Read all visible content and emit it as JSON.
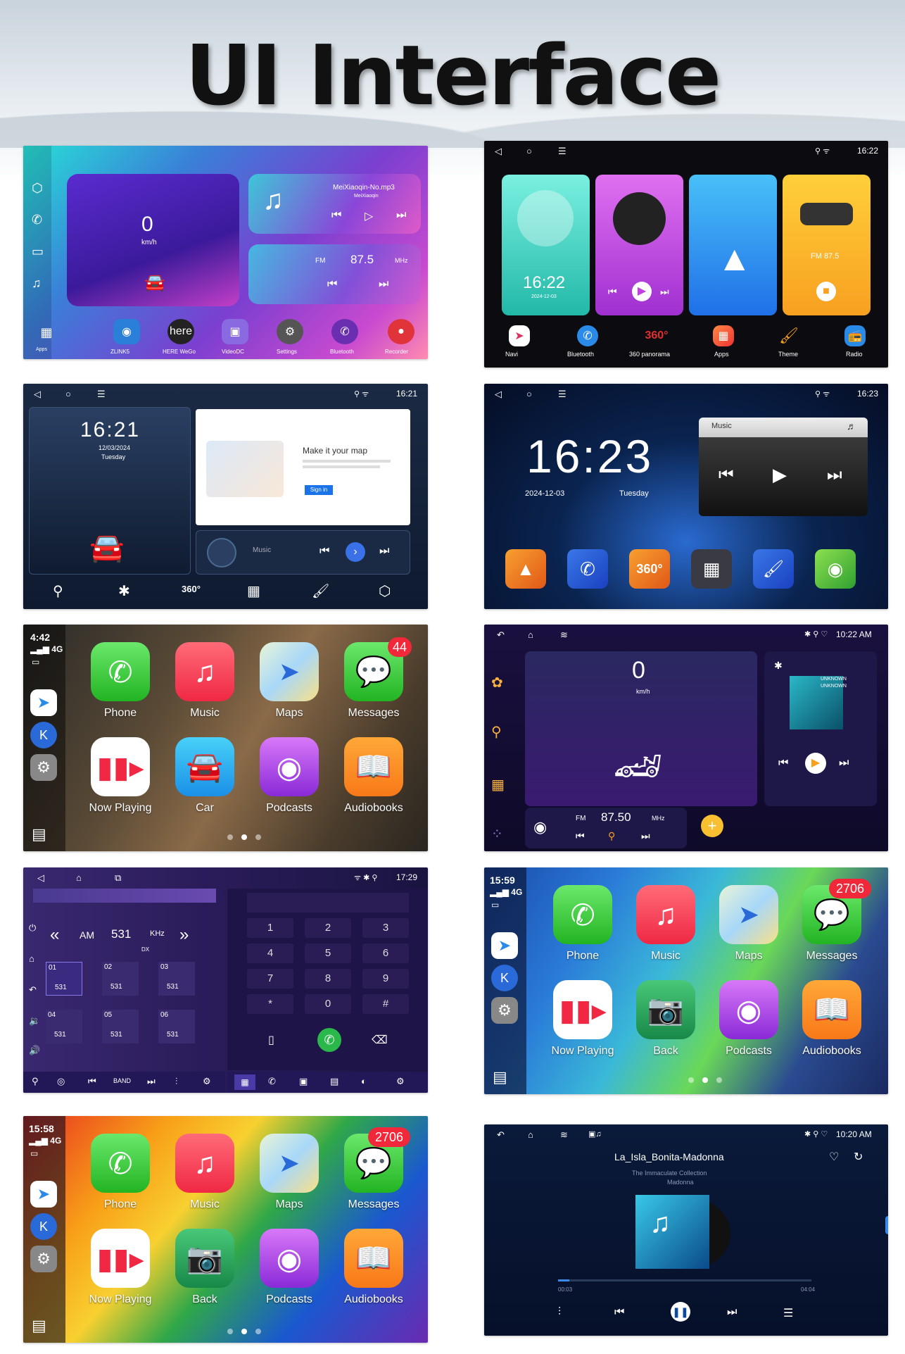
{
  "title": "UI Interface",
  "s1": {
    "speed": "0",
    "unit": "km/h",
    "song": "MeiXiaoqin-No.mp3",
    "artist": "MeiXiaoqin",
    "fm": "FM",
    "freq": "87.5",
    "mhz": "MHz",
    "apps": [
      "Apps",
      "ZLINK5",
      "HERE WeGo",
      "VideoDC",
      "Settings",
      "Bluetooth",
      "Recorder"
    ]
  },
  "s2": {
    "time": "16:22",
    "clock": "16:22",
    "date": "2024-12-03",
    "fm": "FM 87.5",
    "apps": [
      "Navi",
      "Bluetooth",
      "360 panorama",
      "Apps",
      "Theme",
      "Radio"
    ]
  },
  "s3": {
    "time": "16:21",
    "clock": "16:21",
    "date": "12/03/2024",
    "weekday": "Tuesday",
    "map_title": "Make it your map",
    "map_btn": "Sign in",
    "music": "Music"
  },
  "s4": {
    "time": "16:23",
    "clock": "16:23",
    "date": "2024-12-03",
    "weekday": "Tuesday",
    "music": "Music"
  },
  "s5": {
    "time": "4:42",
    "signal": "4G",
    "badge": "44",
    "dots": [
      false,
      true,
      false
    ],
    "apps": [
      "Phone",
      "Music",
      "Maps",
      "Messages",
      "Now Playing",
      "Car",
      "Podcasts",
      "Audiobooks"
    ]
  },
  "s6": {
    "time": "10:22 AM",
    "speed": "0",
    "unit": "km/h",
    "song": "UNKNOWN",
    "artist": "UNKNOWN",
    "fm": "FM",
    "freq": "87.50",
    "mhz": "MHz"
  },
  "s7": {
    "time": "17:29",
    "band": "AM",
    "freq": "531",
    "khz": "KHz",
    "dx": "DX",
    "presets": [
      "01",
      "02",
      "03",
      "04",
      "05",
      "06"
    ],
    "preset_freq": "531",
    "keys": [
      "1",
      "2",
      "3",
      "4",
      "5",
      "6",
      "7",
      "8",
      "9",
      "*",
      "0",
      "#"
    ],
    "band_lbl": "BAND"
  },
  "s8": {
    "time": "15:59",
    "signal": "4G",
    "badge": "2706",
    "apps": [
      "Phone",
      "Music",
      "Maps",
      "Messages",
      "Now Playing",
      "Back",
      "Podcasts",
      "Audiobooks"
    ]
  },
  "s9": {
    "time": "15:58",
    "signal": "4G",
    "badge": "2706",
    "apps": [
      "Phone",
      "Music",
      "Maps",
      "Messages",
      "Now Playing",
      "Back",
      "Podcasts",
      "Audiobooks"
    ]
  },
  "s10": {
    "time": "10:20 AM",
    "song": "La_Isla_Bonita-Madonna",
    "album": "The Immaculate Collection",
    "artist": "Madonna",
    "elapsed": "00:03",
    "duration": "04:04"
  }
}
